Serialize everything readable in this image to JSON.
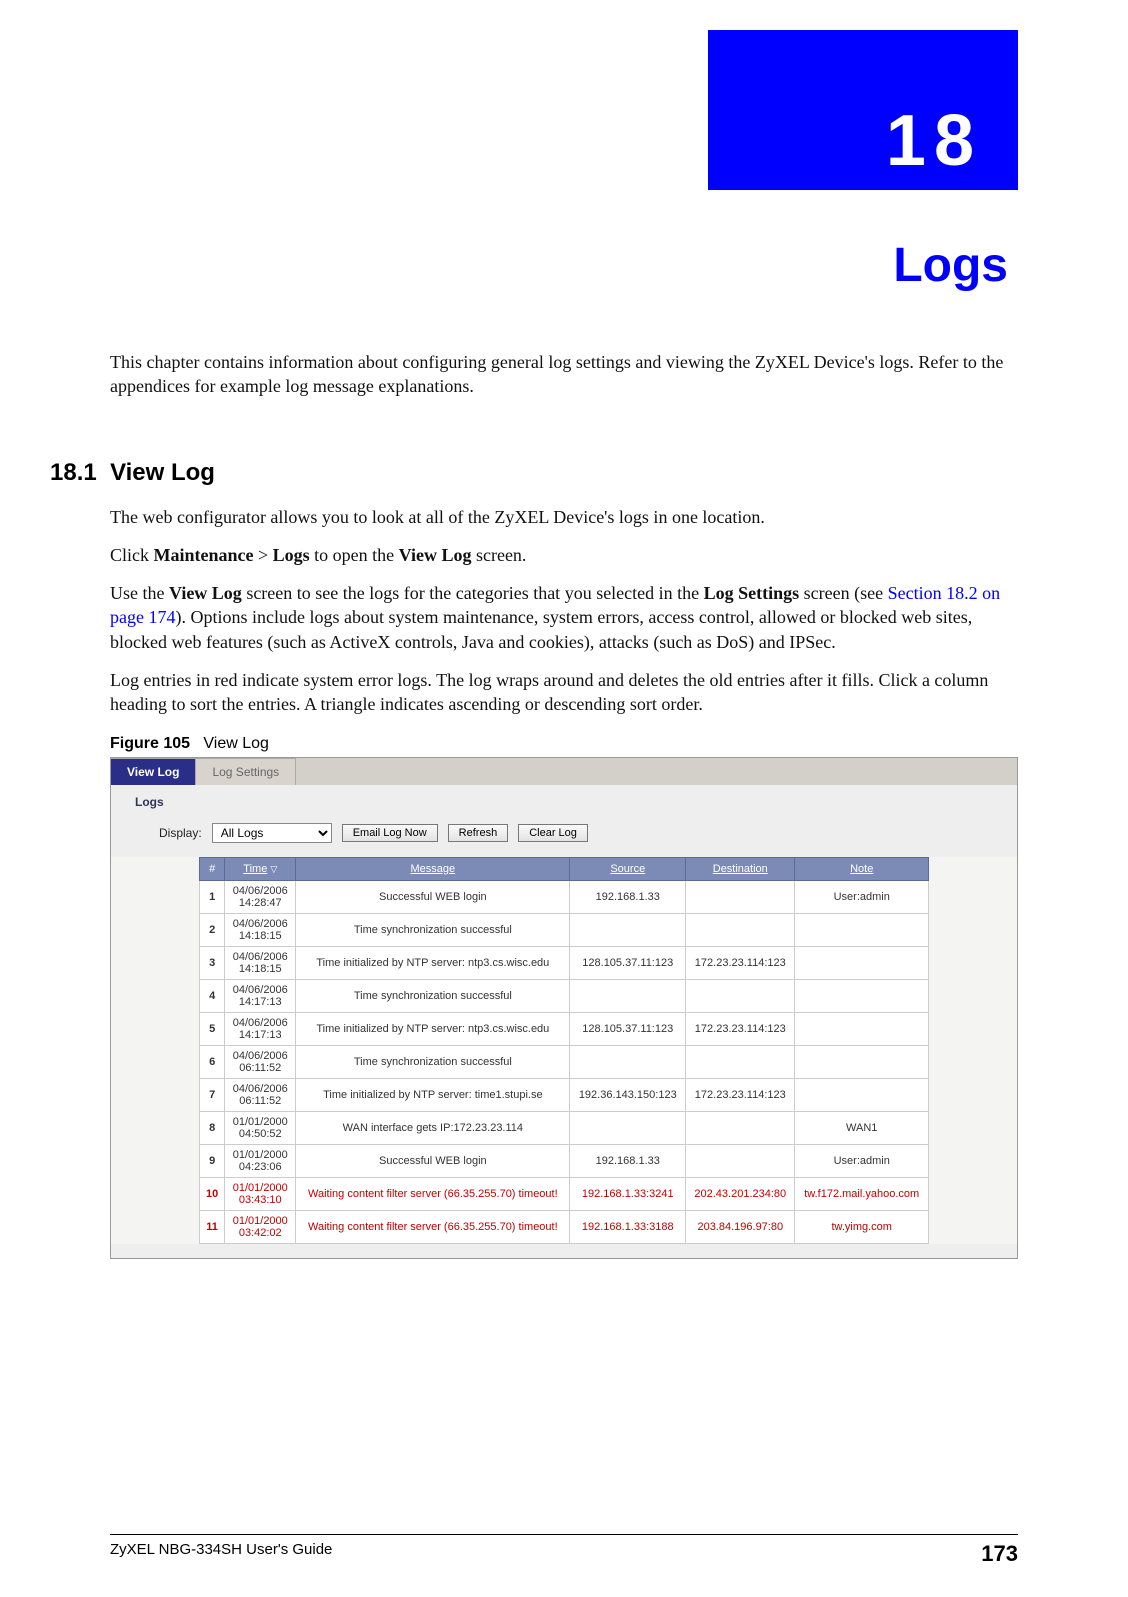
{
  "chapter": {
    "number": "18",
    "title": "Logs"
  },
  "intro": "This chapter contains information about configuring general log settings and viewing the ZyXEL Device's logs. Refer to the appendices for example log message explanations.",
  "section": {
    "num": "18.1",
    "title": "View Log"
  },
  "p1": "The web configurator allows you to look at all of the ZyXEL Device's logs in one location.",
  "p2a": "Click ",
  "p2b": "Maintenance",
  "p2c": " > ",
  "p2d": "Logs",
  "p2e": " to open the ",
  "p2f": "View Log",
  "p2g": " screen.",
  "p3a": "Use the ",
  "p3b": "View Log",
  "p3c": " screen to see the logs for the categories that you selected in the ",
  "p3d": "Log Settings",
  "p3e": " screen (see ",
  "p3link": "Section 18.2 on page 174",
  "p3f": "). Options include logs about system maintenance, system errors, access control, allowed or blocked web sites, blocked web features (such as ActiveX controls, Java and cookies), attacks (such as DoS) and IPSec.",
  "p4": "Log entries in red indicate system error logs. The log wraps around and deletes the old entries after it fills. Click a column heading to sort the entries. A triangle indicates ascending or descending sort order.",
  "figure": {
    "label": "Figure 105",
    "caption": "View Log"
  },
  "shot": {
    "tabs": {
      "active": "View Log",
      "inactive": "Log Settings"
    },
    "group": "Logs",
    "display_label": "Display:",
    "display_value": "All Logs",
    "buttons": {
      "email": "Email Log Now",
      "refresh": "Refresh",
      "clear": "Clear Log"
    },
    "headers": {
      "num": "#",
      "time": "Time",
      "message": "Message",
      "source": "Source",
      "destination": "Destination",
      "note": "Note"
    },
    "rows": [
      {
        "n": "1",
        "time": "04/06/2006 14:28:47",
        "msg": "Successful WEB login",
        "src": "192.168.1.33",
        "dst": "",
        "note": "User:admin",
        "err": false
      },
      {
        "n": "2",
        "time": "04/06/2006 14:18:15",
        "msg": "Time synchronization successful",
        "src": "",
        "dst": "",
        "note": "",
        "err": false
      },
      {
        "n": "3",
        "time": "04/06/2006 14:18:15",
        "msg": "Time initialized by NTP server: ntp3.cs.wisc.edu",
        "src": "128.105.37.11:123",
        "dst": "172.23.23.114:123",
        "note": "",
        "err": false
      },
      {
        "n": "4",
        "time": "04/06/2006 14:17:13",
        "msg": "Time synchronization successful",
        "src": "",
        "dst": "",
        "note": "",
        "err": false
      },
      {
        "n": "5",
        "time": "04/06/2006 14:17:13",
        "msg": "Time initialized by NTP server: ntp3.cs.wisc.edu",
        "src": "128.105.37.11:123",
        "dst": "172.23.23.114:123",
        "note": "",
        "err": false
      },
      {
        "n": "6",
        "time": "04/06/2006 06:11:52",
        "msg": "Time synchronization successful",
        "src": "",
        "dst": "",
        "note": "",
        "err": false
      },
      {
        "n": "7",
        "time": "04/06/2006 06:11:52",
        "msg": "Time initialized by NTP server: time1.stupi.se",
        "src": "192.36.143.150:123",
        "dst": "172.23.23.114:123",
        "note": "",
        "err": false
      },
      {
        "n": "8",
        "time": "01/01/2000 04:50:52",
        "msg": "WAN interface gets IP:172.23.23.114",
        "src": "",
        "dst": "",
        "note": "WAN1",
        "err": false
      },
      {
        "n": "9",
        "time": "01/01/2000 04:23:06",
        "msg": "Successful WEB login",
        "src": "192.168.1.33",
        "dst": "",
        "note": "User:admin",
        "err": false
      },
      {
        "n": "10",
        "time": "01/01/2000 03:43:10",
        "msg": "Waiting content filter server (66.35.255.70) timeout!",
        "src": "192.168.1.33:3241",
        "dst": "202.43.201.234:80",
        "note": "tw.f172.mail.yahoo.com",
        "err": true
      },
      {
        "n": "11",
        "time": "01/01/2000 03:42:02",
        "msg": "Waiting content filter server (66.35.255.70) timeout!",
        "src": "192.168.1.33:3188",
        "dst": "203.84.196.97:80",
        "note": "tw.yimg.com",
        "err": true
      }
    ]
  },
  "footer": {
    "guide": "ZyXEL NBG-334SH User's Guide",
    "page": "173"
  }
}
